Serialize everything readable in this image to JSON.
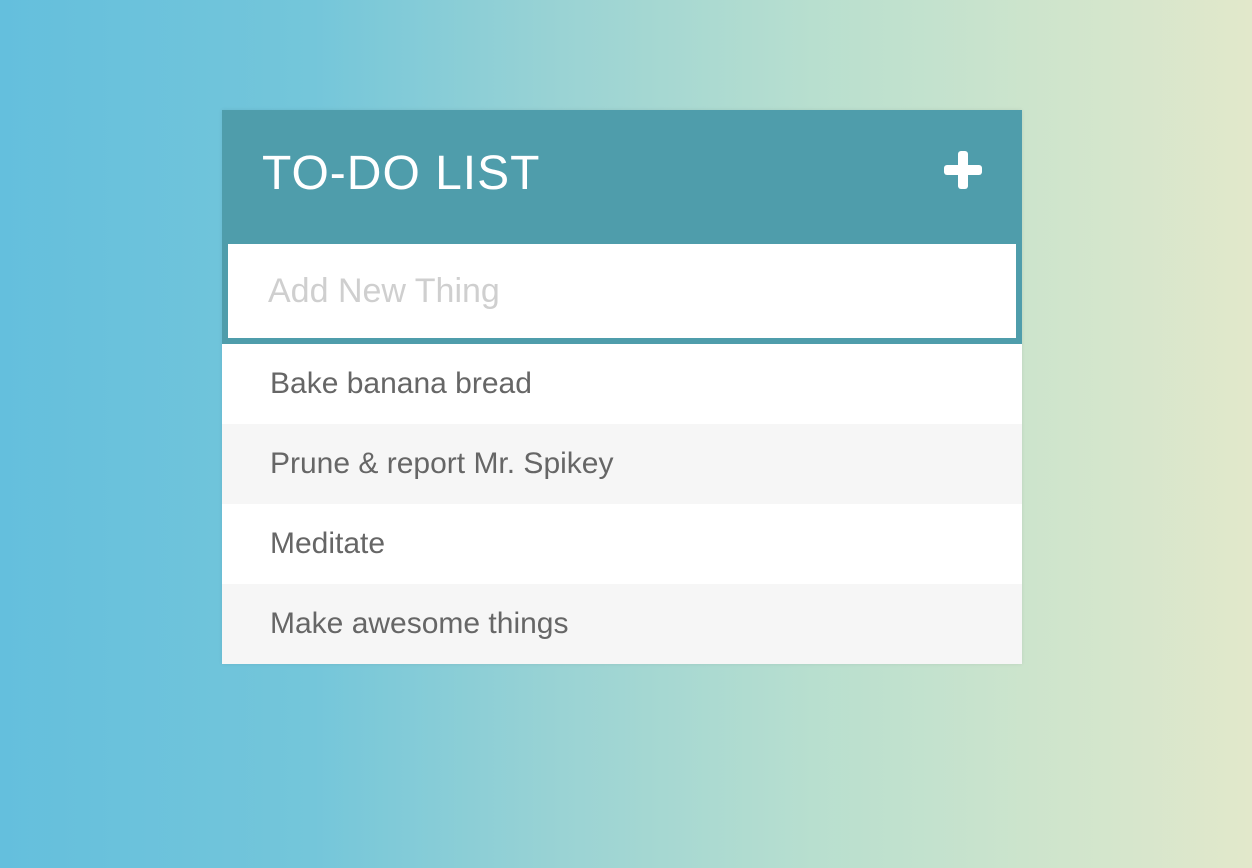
{
  "colors": {
    "accent": "#4f9dab",
    "item_text": "#666666",
    "alt_row": "#f6f6f6",
    "placeholder": "#cfcfcf"
  },
  "header": {
    "title": "TO-DO LIST",
    "add_icon": "plus-icon"
  },
  "new_item": {
    "placeholder": "Add New Thing",
    "value": ""
  },
  "todos": [
    {
      "text": "Bake banana bread"
    },
    {
      "text": "Prune & report Mr. Spikey"
    },
    {
      "text": "Meditate"
    },
    {
      "text": "Make awesome things"
    }
  ]
}
